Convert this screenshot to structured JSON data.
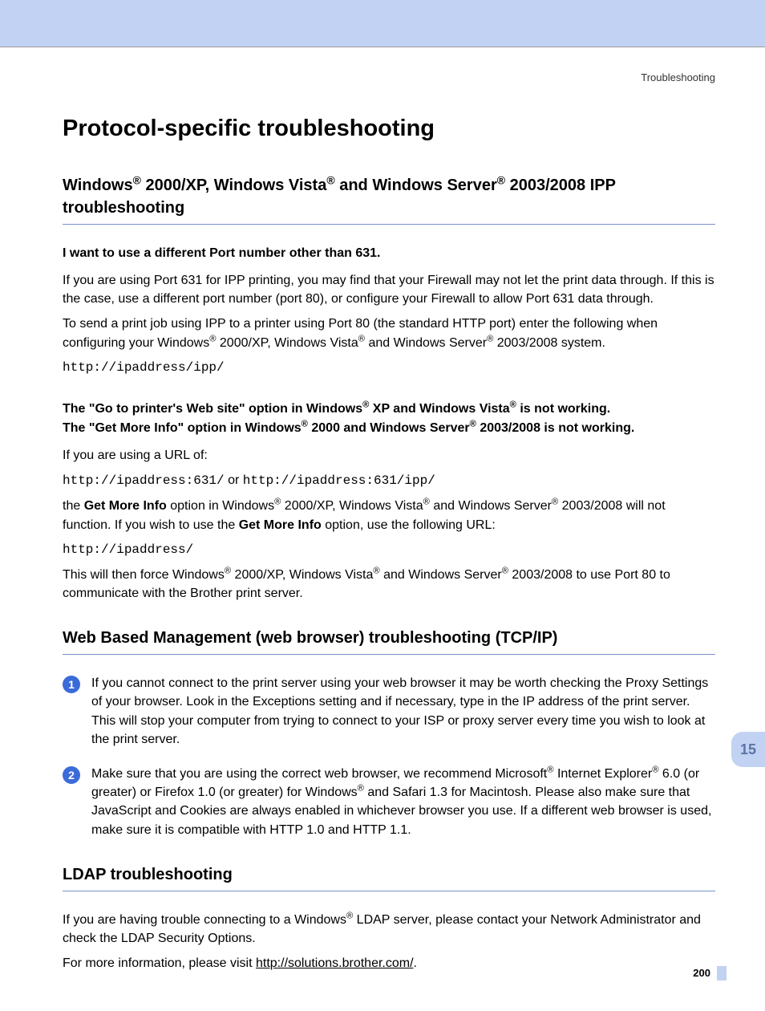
{
  "breadcrumb": "Troubleshooting",
  "chapter_tab": "15",
  "page_number": "200",
  "h1": "Protocol-specific troubleshooting",
  "s1": {
    "heading_pre": "Windows",
    "heading_mid1": " 2000/XP, Windows Vista",
    "heading_mid2": " and Windows Server",
    "heading_post": " 2003/2008 IPP troubleshooting",
    "sub1": "I want to use a different Port number other than 631.",
    "p1": "If you are using Port 631 for IPP printing, you may find that your Firewall may not let the print data through. If this is the case, use a different port number (port 80), or configure your Firewall to allow Port 631 data through.",
    "p2a": "To send a print job using IPP to a printer using Port 80 (the standard HTTP port) enter the following when configuring your Windows",
    "p2b": " 2000/XP, Windows Vista",
    "p2c": " and Windows Server",
    "p2d": " 2003/2008 system.",
    "code1": "http://ipaddress/ipp/",
    "sub2a": "The \"Go to printer's Web site\" option in Windows",
    "sub2b": " XP and Windows Vista",
    "sub2c": " is not working.",
    "sub3a": "The \"Get More Info\" option in Windows",
    "sub3b": " 2000 and Windows Server",
    "sub3c": " 2003/2008 is not working.",
    "p3": "If you are using a URL of:",
    "code2a": "http://ipaddress:631/",
    "code2_or": " or ",
    "code2b": "http://ipaddress:631/ipp/",
    "p4a": "the ",
    "p4_b1": "Get More Info",
    "p4b": " option in Windows",
    "p4c": " 2000/XP, Windows Vista",
    "p4d": " and Windows Server",
    "p4e": " 2003/2008 will not function. If you wish to use the ",
    "p4_b2": "Get More Info",
    "p4f": " option, use the following URL:",
    "code3": "http://ipaddress/",
    "p5a": "This will then force Windows",
    "p5b": " 2000/XP, Windows Vista",
    "p5c": " and Windows Server",
    "p5d": " 2003/2008 to use Port 80 to communicate with the Brother print server."
  },
  "s2": {
    "heading": "Web Based Management (web browser) troubleshooting (TCP/IP)",
    "n1": "1",
    "li1": "If you cannot connect to the print server using your web browser it may be worth checking the Proxy Settings of your browser. Look in the Exceptions setting and if necessary, type in the IP address of the print server. This will stop your computer from trying to connect to your ISP or proxy server every time you wish to look at the print server.",
    "n2": "2",
    "li2a": "Make sure that you are using the correct web browser, we recommend Microsoft",
    "li2b": " Internet Explorer",
    "li2c": " 6.0 (or greater) or Firefox 1.0 (or greater) for Windows",
    "li2d": " and Safari 1.3 for Macintosh. Please also make sure that JavaScript and Cookies are always enabled in whichever browser you use. If a different web browser is used, make sure it is compatible with HTTP 1.0 and HTTP 1.1."
  },
  "s3": {
    "heading": "LDAP troubleshooting",
    "p1a": "If you are having trouble connecting to a Windows",
    "p1b": " LDAP server, please contact your Network Administrator and check the LDAP Security Options.",
    "p2a": "For more information, please visit ",
    "link": "http://solutions.brother.com/",
    "p2b": "."
  }
}
